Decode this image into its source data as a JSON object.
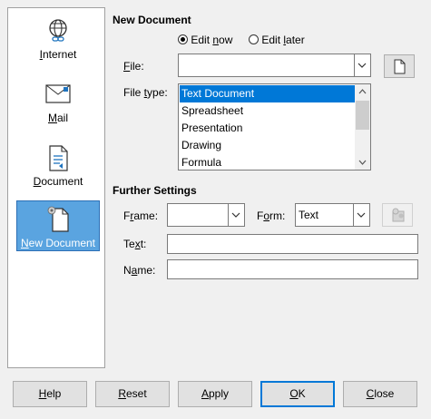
{
  "sidebar": {
    "items": [
      {
        "label": "Internet",
        "accel": "I",
        "rest": "nternet",
        "icon": "internet-globe-link-icon"
      },
      {
        "label": "Mail",
        "accel": "M",
        "rest": "ail",
        "icon": "mail-envelope-icon"
      },
      {
        "label": "Document",
        "accel": "D",
        "rest": "ocument",
        "icon": "document-icon"
      },
      {
        "label": "New Document",
        "accel": "N",
        "rest": "ew Document",
        "icon": "new-document-icon",
        "selected": true
      }
    ]
  },
  "new_document": {
    "heading": "New Document",
    "edit_now": {
      "pre": "Edit ",
      "accel": "n",
      "post": "ow",
      "checked": true
    },
    "edit_later": {
      "pre": "Edit ",
      "accel": "l",
      "post": "ater",
      "checked": false
    },
    "file_label": {
      "accel": "F",
      "rest": "ile:"
    },
    "file_value": "",
    "browse_icon": "blank-page-icon",
    "file_type_label": {
      "pre": "File ",
      "accel": "t",
      "post": "ype:"
    },
    "file_types": [
      "Text Document",
      "Spreadsheet",
      "Presentation",
      "Drawing",
      "Formula"
    ],
    "selected_file_type": "Text Document"
  },
  "further_settings": {
    "heading": "Further Settings",
    "frame_label": {
      "pre": "F",
      "accel": "r",
      "post": "ame:"
    },
    "frame_value": "",
    "form_label": {
      "pre": "F",
      "accel": "o",
      "post": "rm:"
    },
    "form_value": "Text",
    "event_button_icon": "event-macro-icon",
    "text_label": {
      "pre": "Te",
      "accel": "x",
      "post": "t:"
    },
    "text_value": "",
    "name_label": {
      "pre": "N",
      "accel": "a",
      "post": "me:"
    },
    "name_value": ""
  },
  "buttons": {
    "help": {
      "accel": "H",
      "rest": "elp"
    },
    "reset": {
      "accel": "R",
      "rest": "eset"
    },
    "apply": {
      "accel": "A",
      "rest": "pply"
    },
    "ok": {
      "accel": "O",
      "rest": "K"
    },
    "close": {
      "accel": "C",
      "rest": "lose"
    }
  },
  "colors": {
    "selection": "#0078d7",
    "sidebar_selected": "#5aa4e0"
  }
}
